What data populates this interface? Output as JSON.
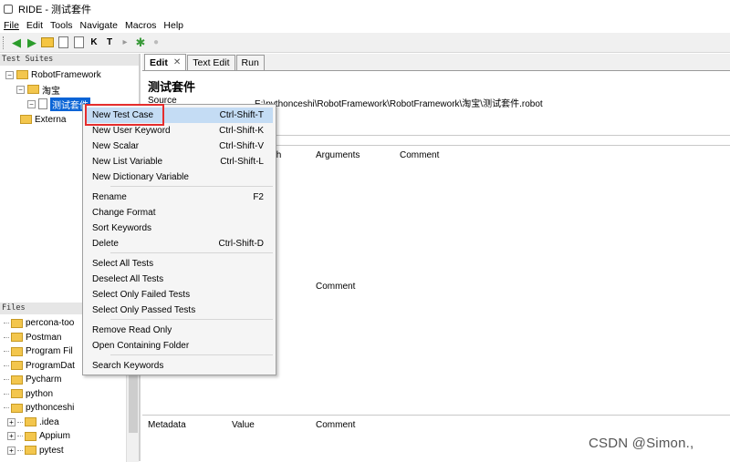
{
  "window": {
    "title": "RIDE - 测试套件"
  },
  "menubar": [
    {
      "label": "File",
      "underline": "F"
    },
    {
      "label": "Edit",
      "underline": "E"
    },
    {
      "label": "Tools",
      "underline": "T"
    },
    {
      "label": "Navigate",
      "underline": "N"
    },
    {
      "label": "Macros",
      "underline": "M"
    },
    {
      "label": "Help",
      "underline": "H"
    }
  ],
  "toolbar": {
    "icons": [
      "back-arrow-icon",
      "forward-arrow-icon",
      "open-folder-icon",
      "save-icon",
      "save-all-icon",
      "keyword-search-icon",
      "test-search-icon",
      "run-icon",
      "settings-icon",
      "stop-icon"
    ]
  },
  "left": {
    "suites_header": "Test Suites",
    "tree": {
      "root": "RobotFramework",
      "child": "淘宝",
      "selected": "测试套件",
      "external": "Externa"
    },
    "files_header": "Files",
    "files": [
      {
        "label": "percona-too",
        "expandable": false
      },
      {
        "label": "Postman",
        "expandable": false
      },
      {
        "label": "Program Fil",
        "expandable": false
      },
      {
        "label": "ProgramDat",
        "expandable": false
      },
      {
        "label": "Pycharm",
        "expandable": false
      },
      {
        "label": "python",
        "expandable": false
      },
      {
        "label": "pythonceshi",
        "expandable": false
      },
      {
        "label": ".idea",
        "expandable": true
      },
      {
        "label": "Appium",
        "expandable": true
      },
      {
        "label": "pytest",
        "expandable": true
      }
    ]
  },
  "tabs": [
    {
      "label": "Edit",
      "active": true,
      "close": "✕"
    },
    {
      "label": "Text Edit",
      "active": false
    },
    {
      "label": "Run",
      "active": false
    }
  ],
  "editor": {
    "suite_title": "测试套件",
    "source_label": "Source",
    "source_value": "E:\\pythonceshi\\RobotFramework\\RobotFramework\\淘宝\\测试套件.robot",
    "import_headers": {
      "partial": "th",
      "arguments": "Arguments",
      "comment": "Comment"
    },
    "variables_comment": "Comment",
    "metadata_headers": {
      "metadata": "Metadata",
      "value": "Value",
      "comment": "Comment"
    }
  },
  "context_menu": {
    "items": [
      {
        "label": "New Test Case",
        "shortcut": "Ctrl-Shift-T",
        "highlighted": true
      },
      {
        "label": "New User Keyword",
        "shortcut": "Ctrl-Shift-K"
      },
      {
        "label": "New Scalar",
        "shortcut": "Ctrl-Shift-V"
      },
      {
        "label": "New List Variable",
        "shortcut": "Ctrl-Shift-L"
      },
      {
        "label": "New Dictionary Variable",
        "shortcut": ""
      },
      {
        "label": "Rename",
        "shortcut": "F2"
      },
      {
        "label": "Change Format",
        "shortcut": ""
      },
      {
        "label": "Sort Keywords",
        "shortcut": ""
      },
      {
        "label": "Delete",
        "shortcut": "Ctrl-Shift-D"
      },
      {
        "label": "Select All Tests",
        "shortcut": ""
      },
      {
        "label": "Deselect All Tests",
        "shortcut": ""
      },
      {
        "label": "Select Only Failed Tests",
        "shortcut": ""
      },
      {
        "label": "Select Only Passed Tests",
        "shortcut": ""
      },
      {
        "label": "Remove Read Only",
        "shortcut": ""
      },
      {
        "label": "Open Containing Folder",
        "shortcut": ""
      },
      {
        "label": "Search Keywords",
        "shortcut": ""
      }
    ]
  },
  "watermark": "CSDN @Simon.,"
}
